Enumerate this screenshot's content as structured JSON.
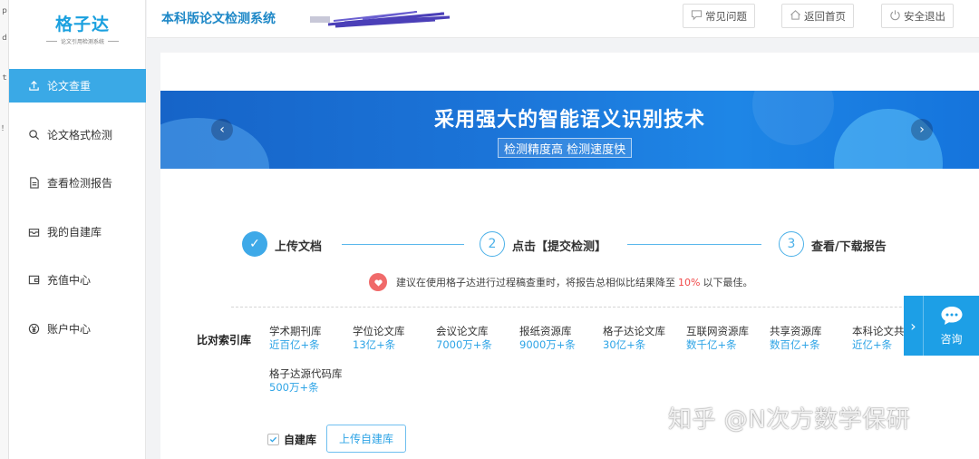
{
  "edge_marks": [
    "ｐ",
    "ｄ",
    "ｔ",
    "！"
  ],
  "logo": {
    "main": "格子达",
    "sub": "论文引用检测系统"
  },
  "sidebar": {
    "items": [
      {
        "label": "论文查重",
        "icon": "upload-icon",
        "active": true
      },
      {
        "label": "论文格式检测",
        "icon": "search-icon",
        "active": false
      },
      {
        "label": "查看检测报告",
        "icon": "document-icon",
        "active": false
      },
      {
        "label": "我的自建库",
        "icon": "inbox-icon",
        "active": false
      },
      {
        "label": "充值中心",
        "icon": "wallet-icon",
        "active": false
      },
      {
        "label": "账户中心",
        "icon": "yen-icon",
        "active": false
      }
    ]
  },
  "header": {
    "title": "本科版论文检测系统",
    "buttons": {
      "faq": "常见问题",
      "home": "返回首页",
      "logout": "安全退出"
    }
  },
  "banner": {
    "title": "采用强大的智能语义识别技术",
    "subtitle": "检测精度高 检测速度快",
    "prev": "‹",
    "next": "›"
  },
  "steps": [
    {
      "marker": "✓",
      "label": "上传文档",
      "done": true
    },
    {
      "marker": "2",
      "label": "点击【提交检测】",
      "done": false
    },
    {
      "marker": "3",
      "label": "查看/下载报告",
      "done": false
    }
  ],
  "tip": {
    "before": "建议在使用格子达进行过程稿查重时，将报告总相似比结果降至",
    "percent": "10%",
    "after": "以下最佳。"
  },
  "libraries": {
    "label": "比对索引库",
    "items": [
      {
        "name": "学术期刊库",
        "count": "近百亿+条"
      },
      {
        "name": "学位论文库",
        "count": "13亿+条"
      },
      {
        "name": "会议论文库",
        "count": "7000万+条"
      },
      {
        "name": "报纸资源库",
        "count": "9000万+条"
      },
      {
        "name": "格子达论文库",
        "count": "30亿+条"
      },
      {
        "name": "互联网资源库",
        "count": "数千亿+条"
      },
      {
        "name": "共享资源库",
        "count": "数百亿+条"
      },
      {
        "name": "本科论文共",
        "count": "近亿+条"
      },
      {
        "name": "格子达源代码库",
        "count": "500万+条"
      }
    ]
  },
  "self_library": {
    "label": "自建库",
    "checked": true,
    "upload_button": "上传自建库"
  },
  "consult": {
    "label": "咨询",
    "arrow": "›"
  },
  "watermark": "知乎 @N次方数学保研",
  "colors": {
    "accent": "#3aa9e6",
    "title_blue": "#1e88c7",
    "count_blue": "#2ea4e6",
    "warning_red": "#f04a4a"
  }
}
